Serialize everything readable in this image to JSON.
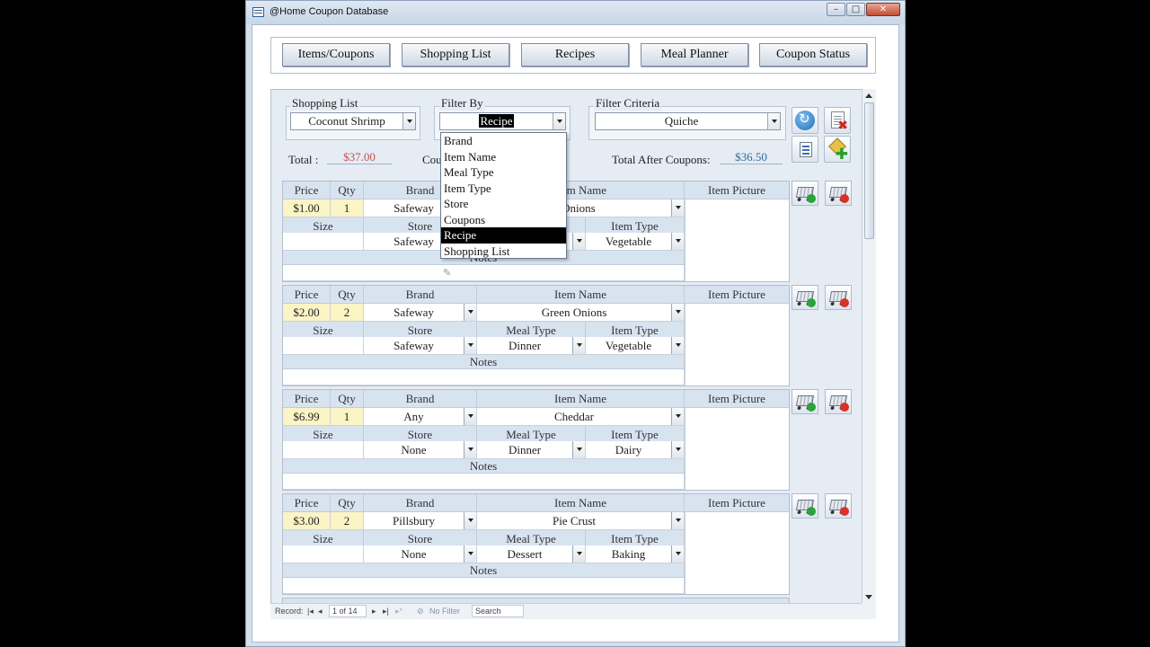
{
  "window": {
    "title": "@Home Coupon Database",
    "min_label": "–",
    "max_label": "□",
    "close_label": "✕"
  },
  "nav": {
    "tabs": [
      {
        "label": "Items/Coupons"
      },
      {
        "label": "Shopping List"
      },
      {
        "label": "Recipes"
      },
      {
        "label": "Meal Planner"
      },
      {
        "label": "Coupon Status"
      }
    ]
  },
  "filters": {
    "shopping_list_label": "Shopping List",
    "shopping_list_value": "Coconut Shrimp",
    "filter_by_label": "Filter By",
    "filter_by_value": "Recipe",
    "filter_criteria_label": "Filter Criteria",
    "filter_criteria_value": "Quiche",
    "filter_by_options": [
      "Brand",
      "Item Name",
      "Meal Type",
      "Item Type",
      "Store",
      "Coupons",
      "Recipe",
      "Shopping List"
    ],
    "selected_option_index": 6
  },
  "totals": {
    "total_label": "Total :",
    "total_value": "$37.00",
    "coupons_label_partial": "Cou",
    "after_coupons_label": "Total After Coupons:",
    "after_coupons_value": "$36.50"
  },
  "columns": {
    "price": "Price",
    "qty": "Qty",
    "brand": "Brand",
    "item_name": "Item Name",
    "item_picture": "Item Picture",
    "size": "Size",
    "store": "Store",
    "meal_type": "Meal Type",
    "item_type": "Item Type",
    "notes": "Notes"
  },
  "records": [
    {
      "price": "$1.00",
      "qty": "1",
      "brand": "Safeway",
      "item_name": "Green Onions",
      "item_name_visible": "n Onions",
      "size": "",
      "store": "Safeway",
      "meal_type": "",
      "item_type": "Vegetable",
      "notes": ""
    },
    {
      "price": "$2.00",
      "qty": "2",
      "brand": "Safeway",
      "item_name": "Green Onions",
      "size": "",
      "store": "Safeway",
      "meal_type": "Dinner",
      "item_type": "Vegetable",
      "notes": ""
    },
    {
      "price": "$6.99",
      "qty": "1",
      "brand": "Any",
      "item_name": "Cheddar",
      "size": "",
      "store": "None",
      "meal_type": "Dinner",
      "item_type": "Dairy",
      "notes": ""
    },
    {
      "price": "$3.00",
      "qty": "2",
      "brand": "Pillsbury",
      "item_name": "Pie Crust",
      "size": "",
      "store": "None",
      "meal_type": "Dessert",
      "item_type": "Baking",
      "notes": ""
    }
  ],
  "record_nav": {
    "record_label": "Record:",
    "first": "|◂",
    "prev": "◂",
    "position": "1 of 14",
    "next": "▸",
    "last": "▸|",
    "new": "▸*",
    "filter_status": "No Filter",
    "search_placeholder": "Search"
  },
  "colors": {
    "total_value": "#c0504d",
    "after_coupons_value": "#2f6a9a",
    "header_band": "#d8e3f0",
    "price_cell": "#fbf5c5",
    "selected_option": "#000000"
  }
}
